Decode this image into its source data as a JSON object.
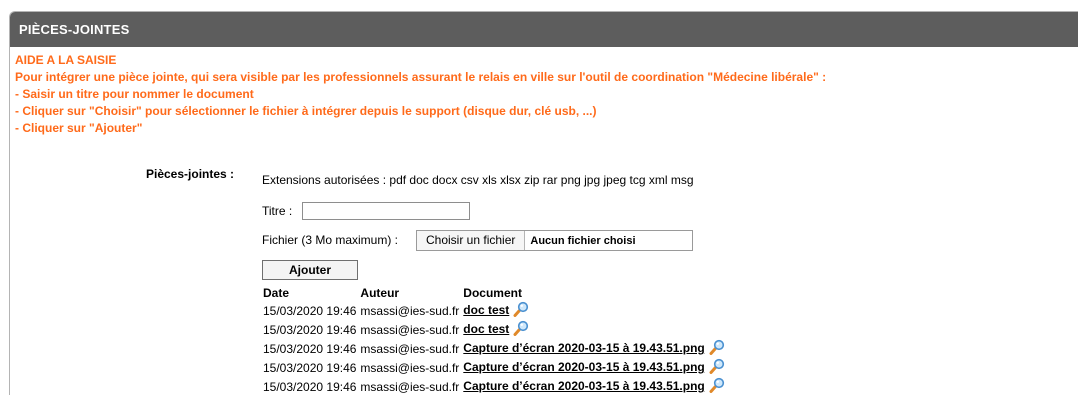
{
  "panel": {
    "title": "PIÈCES-JOINTES"
  },
  "help": {
    "heading": "AIDE A LA SAISIE",
    "line1": "Pour intégrer une pièce jointe, qui sera visible par les professionnels assurant le relais en ville sur l'outil de coordination \"Médecine libérale\" :",
    "line2": "- Saisir un titre pour nommer le document",
    "line3": "- Cliquer sur \"Choisir\" pour sélectionner le fichier à intégrer depuis le support (disque dur, clé usb, ...)",
    "line4": "- Cliquer sur \"Ajouter\""
  },
  "form": {
    "section_label": "Pièces-jointes :",
    "extensions": "Extensions autorisées : pdf doc docx csv xls xlsx zip rar png jpg jpeg tcg xml msg",
    "titre_label": "Titre :",
    "titre_value": "",
    "fichier_label": "Fichier (3 Mo maximum) :",
    "choose_button": "Choisir un fichier",
    "no_file": "Aucun fichier choisi",
    "add_button": "Ajouter"
  },
  "table": {
    "headers": {
      "date": "Date",
      "auteur": "Auteur",
      "document": "Document"
    },
    "rows": [
      {
        "date": "15/03/2020 19:46",
        "auteur": "msassi@ies-sud.fr",
        "document": "doc test"
      },
      {
        "date": "15/03/2020 19:46",
        "auteur": "msassi@ies-sud.fr",
        "document": "doc test"
      },
      {
        "date": "15/03/2020 19:46",
        "auteur": "msassi@ies-sud.fr",
        "document": "Capture d’écran 2020-03-15 à 19.43.51.png"
      },
      {
        "date": "15/03/2020 19:46",
        "auteur": "msassi@ies-sud.fr",
        "document": "Capture d’écran 2020-03-15 à 19.43.51.png"
      },
      {
        "date": "15/03/2020 19:46",
        "auteur": "msassi@ies-sud.fr",
        "document": "Capture d’écran 2020-03-15 à 19.43.51.png"
      }
    ],
    "view_icon": "magnifier-icon"
  },
  "colors": {
    "header_bg": "#5d5d5d",
    "help_text": "#ff6a1a"
  }
}
